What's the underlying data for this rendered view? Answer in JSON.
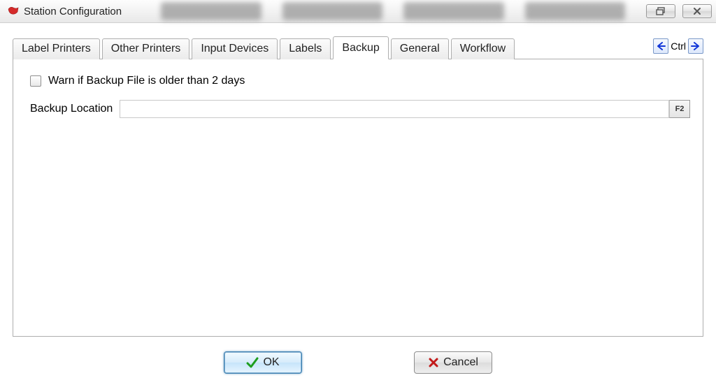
{
  "window": {
    "title": "Station Configuration"
  },
  "tabs": {
    "items": [
      {
        "label": "Label Printers"
      },
      {
        "label": "Other Printers"
      },
      {
        "label": "Input Devices"
      },
      {
        "label": "Labels"
      },
      {
        "label": "Backup"
      },
      {
        "label": "General"
      },
      {
        "label": "Workflow"
      }
    ],
    "active_index": 4,
    "ctrl_label": "Ctrl"
  },
  "backup": {
    "warn_checkbox_label": "Warn if Backup File is older than 2 days",
    "warn_checked": false,
    "location_label": "Backup Location",
    "location_value": "",
    "f2_label": "F2"
  },
  "buttons": {
    "ok": "OK",
    "cancel": "Cancel"
  }
}
